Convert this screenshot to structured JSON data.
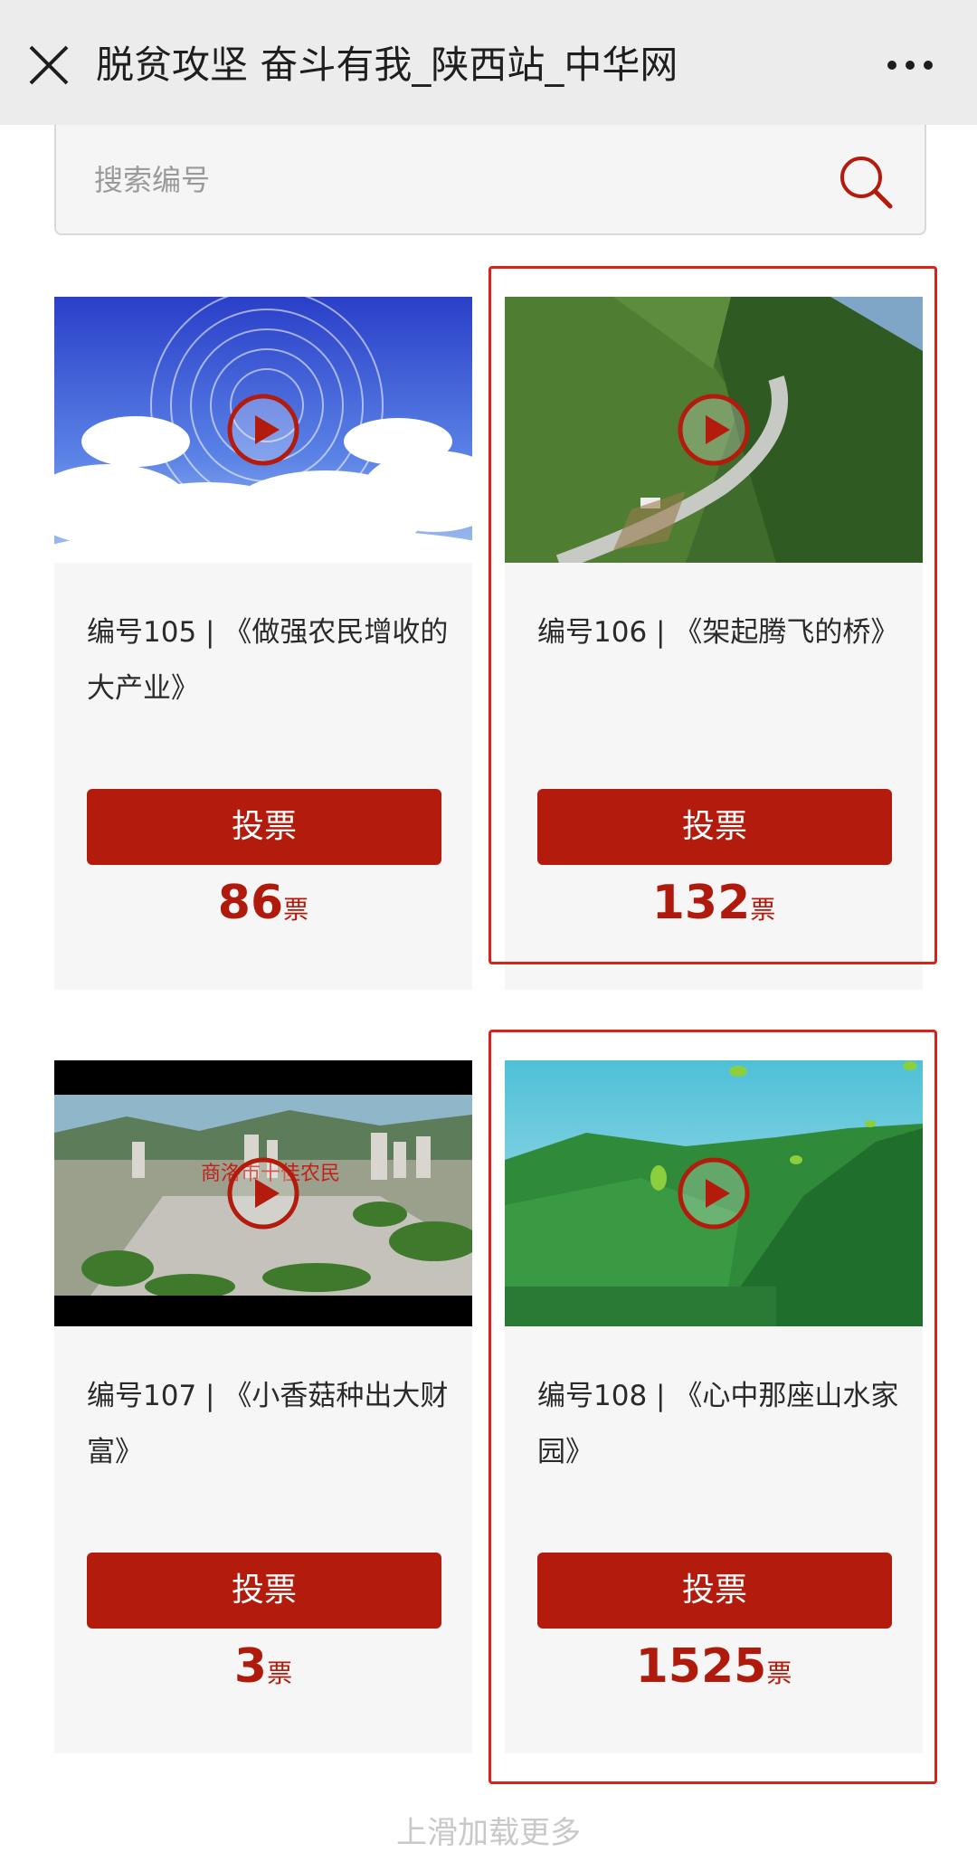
{
  "header": {
    "title": "脱贫攻坚 奋斗有我_陕西站_中华网",
    "close_icon": "close-icon",
    "more_icon": "more-dots-icon"
  },
  "search": {
    "placeholder": "搜索编号",
    "icon": "search-icon"
  },
  "colors": {
    "accent": "#b31b0c",
    "highlight_border": "#d7231a",
    "card_bg": "#f6f6f6",
    "topbar_bg": "#ececec"
  },
  "entries": [
    {
      "caption": "编号105 | 《做强农民增收的大产业》",
      "vote_label": "投票",
      "votes": "86",
      "unit": "票",
      "highlighted": false,
      "thumbnail": "sky-clouds-thumbnail"
    },
    {
      "caption": "编号106 | 《架起腾飞的桥》",
      "vote_label": "投票",
      "votes": "132",
      "unit": "票",
      "highlighted": true,
      "thumbnail": "mountain-road-thumbnail"
    },
    {
      "caption": "编号107 | 《小香菇种出大财富》",
      "vote_label": "投票",
      "votes": "3",
      "unit": "票",
      "highlighted": false,
      "thumbnail": "town-aerial-thumbnail",
      "thumbnail_text": "商洛市十佳农民"
    },
    {
      "caption": "编号108 | 《心中那座山水家园》",
      "vote_label": "投票",
      "votes": "1525",
      "unit": "票",
      "highlighted": true,
      "thumbnail": "green-hills-thumbnail"
    }
  ],
  "footer": {
    "load_more": "上滑加载更多"
  }
}
